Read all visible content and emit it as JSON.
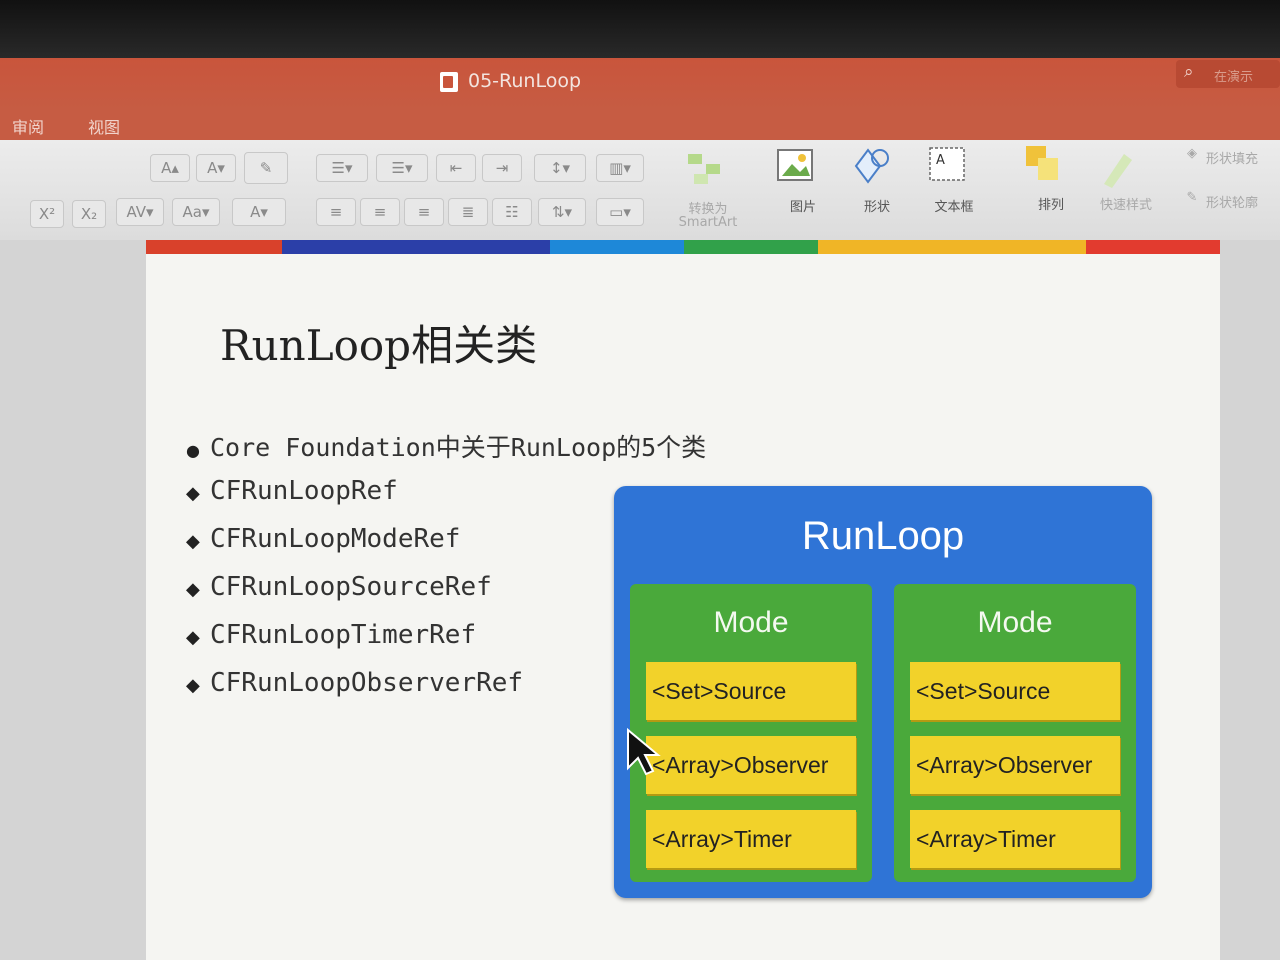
{
  "window": {
    "title": "05-RunLoop"
  },
  "search": {
    "placeholder": "在演示"
  },
  "tabs": [
    "审阅",
    "视图"
  ],
  "ribbon": {
    "smartart_label_1": "转换为",
    "smartart_label_2": "SmartArt",
    "picture_label": "图片",
    "shape_label": "形状",
    "textbox_label": "文本框",
    "arrange_label": "排列",
    "quick_styles_label": "快速样式",
    "shape_fill_label": "形状填充",
    "shape_outline_label": "形状轮廓",
    "font_grow": "A",
    "font_shrink": "A",
    "superscript": "X²",
    "subscript": "X₂",
    "char_spacing": "AV",
    "change_case": "Aa",
    "font_color": "A"
  },
  "slide": {
    "title": "RunLoop相关类",
    "bullets": [
      {
        "mark": "●",
        "text": "Core Foundation中关于RunLoop的5个类"
      },
      {
        "mark": "◆",
        "text": "CFRunLoopRef"
      },
      {
        "mark": "◆",
        "text": "CFRunLoopModeRef"
      },
      {
        "mark": "◆",
        "text": "CFRunLoopSourceRef"
      },
      {
        "mark": "◆",
        "text": "CFRunLoopTimerRef"
      },
      {
        "mark": "◆",
        "text": "CFRunLoopObserverRef"
      }
    ],
    "diagram": {
      "title": "RunLoop",
      "modes": [
        {
          "title": "Mode",
          "items": [
            "<Set>Source",
            "<Array>Observer",
            "<Array>Timer"
          ]
        },
        {
          "title": "Mode",
          "items": [
            "<Set>Source",
            "<Array>Observer",
            "<Array>Timer"
          ]
        }
      ]
    }
  },
  "colors": {
    "titlebar": "#c65c43",
    "runloop_box": "#2f74d6",
    "mode_box": "#4aa93b",
    "item_box": "#f2d22a",
    "stripe": [
      "#d9412b",
      "#2b3fa8",
      "#1e88d8",
      "#31a14a",
      "#f0b526",
      "#e23b2f"
    ]
  }
}
